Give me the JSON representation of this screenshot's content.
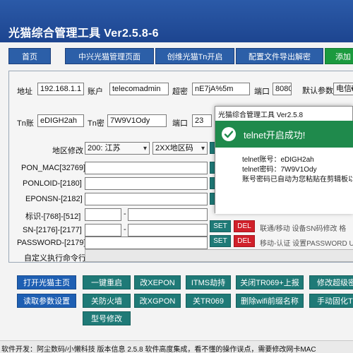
{
  "app": {
    "title": "光猫综合管理工具 Ver2.5.8-6"
  },
  "nav": {
    "items": [
      "首页",
      "中兴光猫管理页面",
      "创维光猫Tn开启",
      "配置文件导出解密",
      "添加"
    ]
  },
  "conn": {
    "addr_label": "地址",
    "addr_value": "192.168.1.1",
    "account_label": "账户",
    "account_value": "telecomadmin",
    "super_label": "超密",
    "super_value": "nE7jA%5m",
    "port_label": "端口",
    "port_value": "8080",
    "default_label": "默认参数",
    "default_value": "电信新"
  },
  "tn": {
    "account_label": "Tn账",
    "account_value": "eDIGH2ah",
    "password_label": "Tn密",
    "password_value": "7W9V1Ody",
    "port_label": "端口",
    "port_value": "23"
  },
  "region": {
    "label": "地区修改",
    "province": "200: 江苏",
    "code": "2XX地区码"
  },
  "fields": [
    {
      "label": "PON_MAC[32769]"
    },
    {
      "label": "PONLOID-[2180]"
    },
    {
      "label": "EPONSN-[2182]"
    },
    {
      "label": "标识-[768]-[512]"
    },
    {
      "label": "SN-[2176]-[2177]",
      "hint": "联通/移动  设备SN码修改  格"
    },
    {
      "label": "PASSWORD-[2179]",
      "hint": "移动-认证  设置PASSWORD U"
    }
  ],
  "custom_cmd": {
    "label": "自定义执行命令行"
  },
  "buttons": {
    "set": "SET",
    "del": "DEL",
    "open_home": "打开光猫主页",
    "one_restart": "一键重启",
    "change_xepon": "改XEPON",
    "itms_hijack": "ITMS劫持",
    "close_tr069": "关闭TR069+上报",
    "modify_super": "修改超级密",
    "read_params": "读取参数设置",
    "close_firewall": "关防火墙",
    "change_xgpon": "改XGPON",
    "close_tr069_short": "关TR069",
    "remove_wifi": "删除wifi前缀名称",
    "manual_fix": "手动固化T",
    "model_modify": "型号修改"
  },
  "dialog": {
    "title": "光猫综合管理工具 Ver2.5.8",
    "header": "telnet开启成功!",
    "line1": "telnet账号：eDIGH2ah",
    "line2": "telnet密码：7W9V1Ody",
    "line3": "账号密码已自动为您粘贴在剪辑板以"
  },
  "status": {
    "text": "软件开发：阿尘数码/小懒科技   版本信息  2.5.8   软件高度集成，看不懂的操作误点，需要修改网卡MAC"
  },
  "colors": {
    "title_bar": "#2b5aa8",
    "teal_button": "#1f7a77",
    "red_button": "#d0202a",
    "success_green": "#1f8a4c"
  }
}
